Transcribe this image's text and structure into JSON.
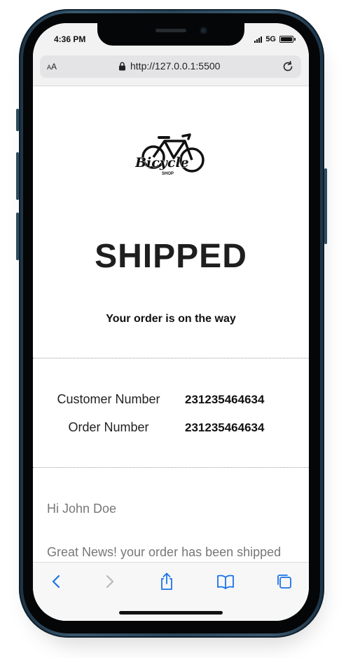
{
  "status_bar": {
    "time": "4:36 PM",
    "network": "5G"
  },
  "browser": {
    "text_size_label_small": "A",
    "text_size_label_large": "A",
    "url": "http://127.0.0.1:5500"
  },
  "email": {
    "logo_text": "Bicycle",
    "logo_subtext": "SHOP",
    "headline": "SHIPPED",
    "subheadline": "Your order is on the way",
    "details": [
      {
        "label": "Customer Number",
        "value": "231235464634"
      },
      {
        "label": "Order Number",
        "value": "231235464634"
      }
    ],
    "greeting": "Hi John Doe",
    "message": "Great News! your order has been shipped"
  },
  "toolbar": {
    "items": [
      "back-icon",
      "forward-icon",
      "share-icon",
      "bookmarks-icon",
      "tabs-icon"
    ]
  },
  "colors": {
    "accent": "#1a73e8",
    "disabled": "#b9b9b9",
    "frame": "#2a4659"
  }
}
